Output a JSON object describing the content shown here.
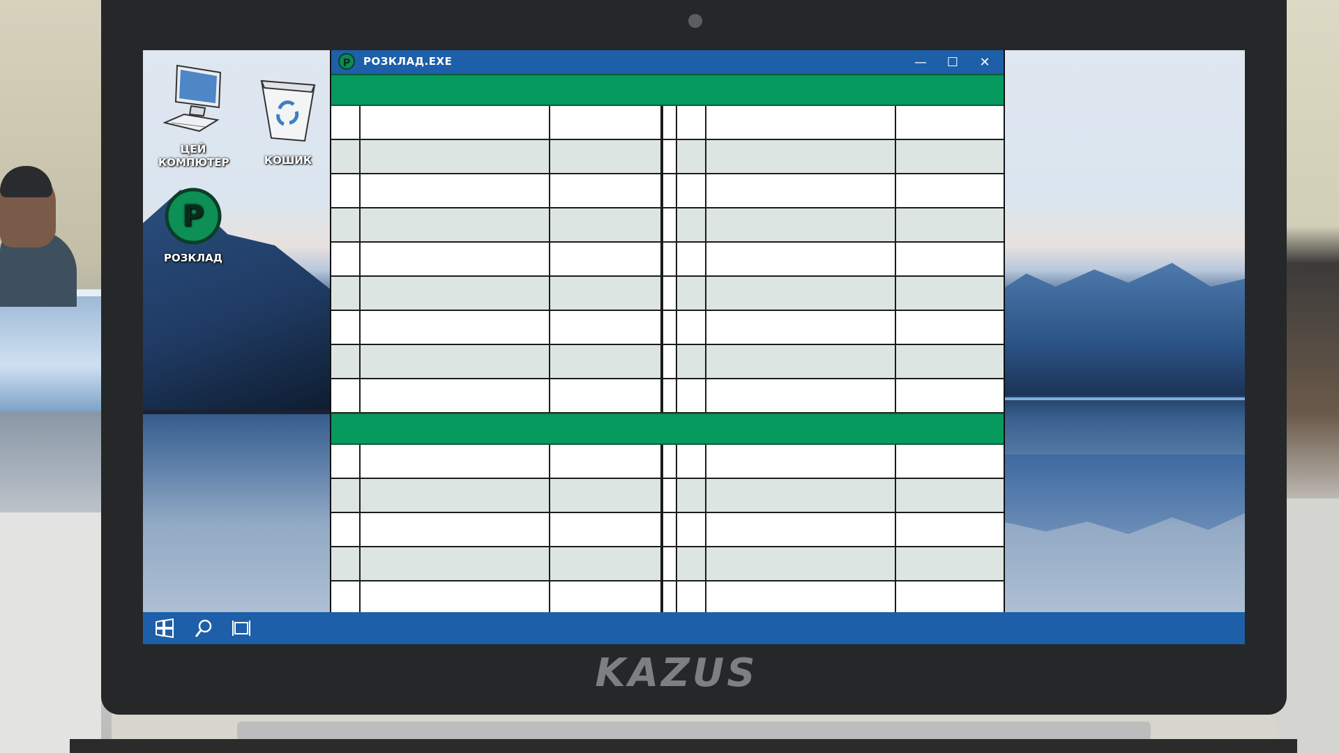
{
  "laptop": {
    "brand": "KAZUS"
  },
  "desktop": {
    "icons": [
      {
        "label_line1": "ЦЕЙ",
        "label_line2": "КОМПЮТЕР",
        "icon": "computer-icon"
      },
      {
        "label": "КОШИК",
        "icon": "recycle-bin-icon"
      },
      {
        "label": "РОЗКЛАД",
        "icon": "schedule-app-icon",
        "glyph": "P"
      }
    ]
  },
  "window": {
    "title": "РОЗКЛАД.EXE",
    "logo_glyph": "P",
    "controls": {
      "minimize": "—",
      "maximize": "☐",
      "close": "✕"
    },
    "sections": [
      {
        "row_count": 9
      },
      {
        "row_count": 5
      }
    ]
  },
  "taskbar": {
    "items": [
      "start-icon",
      "search-icon",
      "task-view-icon"
    ]
  },
  "colors": {
    "titlebar": "#1d5fa8",
    "header_green": "#079a5e",
    "row_alt": "#dde5e3",
    "taskbar": "#1d5fa8"
  }
}
